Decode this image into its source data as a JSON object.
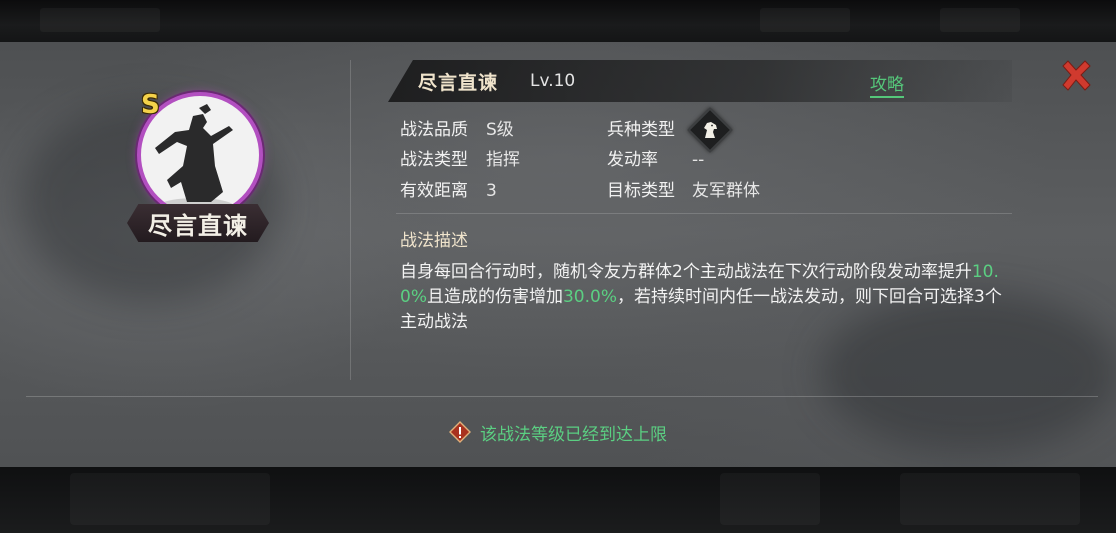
{
  "skill": {
    "name": "尽言直谏",
    "level_label": "Lv.10",
    "grade_badge": "S",
    "strategy_link": "攻略"
  },
  "info": {
    "quality_label": "战法品质",
    "quality_value": "S级",
    "type_label": "战法类型",
    "type_value": "指挥",
    "range_label": "有效距离",
    "range_value": "3",
    "troop_label": "兵种类型",
    "troop_icon": "horse-head-icon",
    "rate_label": "发动率",
    "rate_value": "--",
    "target_label": "目标类型",
    "target_value": "友军群体"
  },
  "description": {
    "title": "战法描述",
    "part1": "自身每回合行动时，随机令友方群体2个主动战法在下次行动阶段发动率提升",
    "value1": "10.0%",
    "part2": "且造成的伤害增加",
    "value2": "30.0%",
    "part3": "，若持续时间内任一战法发动，则下回合可选择3个主动战法"
  },
  "footer": {
    "limit_note": "该战法等级已经到达上限",
    "icon": "warning-icon"
  },
  "colors": {
    "highlight": "#5bcf82",
    "grade_gold": "#f4d24a",
    "portrait_ring": "#b24fc0",
    "close_red": "#d03a2e"
  }
}
